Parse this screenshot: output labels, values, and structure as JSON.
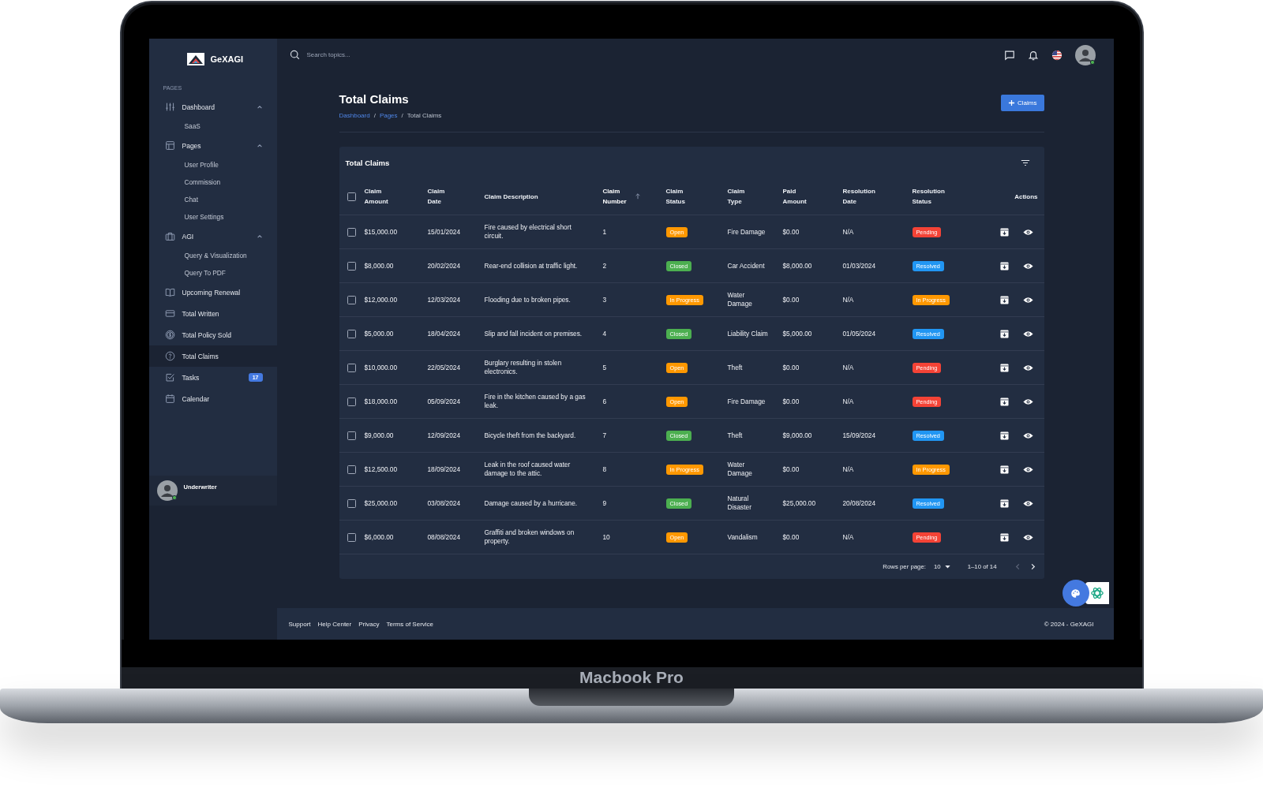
{
  "device": {
    "label": "Macbook Pro"
  },
  "sidebar": {
    "brand": "GeXAGI",
    "section": "PAGES",
    "items": [
      {
        "label": "Dashboard",
        "selected": false,
        "expanded": true,
        "children": [
          {
            "label": "SaaS",
            "selected": false
          }
        ]
      },
      {
        "label": "Pages",
        "selected": false,
        "expanded": true,
        "children": [
          {
            "label": "User Profile",
            "selected": false
          },
          {
            "label": "Commission",
            "selected": false
          },
          {
            "label": "Chat",
            "selected": false
          },
          {
            "label": "User Settings",
            "selected": false
          }
        ]
      },
      {
        "label": "AGI",
        "selected": false,
        "expanded": true,
        "children": [
          {
            "label": "Query & Visualization",
            "selected": false
          },
          {
            "label": "Query To PDF",
            "selected": false
          }
        ]
      },
      {
        "label": "Upcoming Renewal",
        "selected": false
      },
      {
        "label": "Total Written",
        "selected": false
      },
      {
        "label": "Total Policy Sold",
        "selected": false
      },
      {
        "label": "Total Claims",
        "selected": true
      },
      {
        "label": "Tasks",
        "selected": false,
        "badge": "17"
      },
      {
        "label": "Calendar",
        "selected": false
      }
    ],
    "user": {
      "name": "Underwriter",
      "online": true
    }
  },
  "topbar": {
    "search": {
      "placeholder": "Search topics..."
    },
    "avatar_online": true
  },
  "page": {
    "title": "Total Claims",
    "breadcrumb_separator": "/",
    "breadcrumb": [
      {
        "label": "Dashboard",
        "link": true
      },
      {
        "label": "Pages",
        "link": true
      },
      {
        "label": "Total Claims",
        "link": false
      }
    ],
    "add_button": "Claims"
  },
  "table": {
    "title": "Total Claims",
    "all_checked": false,
    "columns": [
      {
        "label": "Claim Amount",
        "sorted": false
      },
      {
        "label": "Claim Date",
        "sorted": false
      },
      {
        "label": "Claim Description",
        "sorted": false
      },
      {
        "label": "Claim Number",
        "sorted": true
      },
      {
        "label": "Claim Status",
        "sorted": false
      },
      {
        "label": "Claim Type",
        "sorted": false
      },
      {
        "label": "Paid Amount",
        "sorted": false
      },
      {
        "label": "Resolution Date",
        "sorted": false
      },
      {
        "label": "Resolution Status",
        "sorted": false
      },
      {
        "label": "Actions",
        "sorted": false
      }
    ],
    "rows": [
      {
        "checked": false,
        "amount": "$15,000.00",
        "date": "15/01/2024",
        "description": "Fire caused by electrical short circuit.",
        "number": "1",
        "status": {
          "label": "Open",
          "color": "#ff9800"
        },
        "type": "Fire Damage",
        "paid": "$0.00",
        "resolution_date": "N/A",
        "resolution_status": {
          "label": "Pending",
          "color": "#f44336"
        }
      },
      {
        "checked": false,
        "amount": "$8,000.00",
        "date": "20/02/2024",
        "description": "Rear-end collision at traffic light.",
        "number": "2",
        "status": {
          "label": "Closed",
          "color": "#4caf50"
        },
        "type": "Car Accident",
        "paid": "$8,000.00",
        "resolution_date": "01/03/2024",
        "resolution_status": {
          "label": "Resolved",
          "color": "#2196f3"
        }
      },
      {
        "checked": false,
        "amount": "$12,000.00",
        "date": "12/03/2024",
        "description": "Flooding due to broken pipes.",
        "number": "3",
        "status": {
          "label": "In Progress",
          "color": "#ff9800"
        },
        "type": "Water Damage",
        "paid": "$0.00",
        "resolution_date": "N/A",
        "resolution_status": {
          "label": "In Progress",
          "color": "#ff9800"
        }
      },
      {
        "checked": false,
        "amount": "$5,000.00",
        "date": "18/04/2024",
        "description": "Slip and fall incident on premises.",
        "number": "4",
        "status": {
          "label": "Closed",
          "color": "#4caf50"
        },
        "type": "Liability Claim",
        "paid": "$5,000.00",
        "resolution_date": "01/05/2024",
        "resolution_status": {
          "label": "Resolved",
          "color": "#2196f3"
        }
      },
      {
        "checked": false,
        "amount": "$10,000.00",
        "date": "22/05/2024",
        "description": "Burglary resulting in stolen electronics.",
        "number": "5",
        "status": {
          "label": "Open",
          "color": "#ff9800"
        },
        "type": "Theft",
        "paid": "$0.00",
        "resolution_date": "N/A",
        "resolution_status": {
          "label": "Pending",
          "color": "#f44336"
        }
      },
      {
        "checked": false,
        "amount": "$18,000.00",
        "date": "05/09/2024",
        "description": "Fire in the kitchen caused by a gas leak.",
        "number": "6",
        "status": {
          "label": "Open",
          "color": "#ff9800"
        },
        "type": "Fire Damage",
        "paid": "$0.00",
        "resolution_date": "N/A",
        "resolution_status": {
          "label": "Pending",
          "color": "#f44336"
        }
      },
      {
        "checked": false,
        "amount": "$9,000.00",
        "date": "12/09/2024",
        "description": "Bicycle theft from the backyard.",
        "number": "7",
        "status": {
          "label": "Closed",
          "color": "#4caf50"
        },
        "type": "Theft",
        "paid": "$9,000.00",
        "resolution_date": "15/09/2024",
        "resolution_status": {
          "label": "Resolved",
          "color": "#2196f3"
        }
      },
      {
        "checked": false,
        "amount": "$12,500.00",
        "date": "18/09/2024",
        "description": "Leak in the roof caused water damage to the attic.",
        "number": "8",
        "status": {
          "label": "In Progress",
          "color": "#ff9800"
        },
        "type": "Water Damage",
        "paid": "$0.00",
        "resolution_date": "N/A",
        "resolution_status": {
          "label": "In Progress",
          "color": "#ff9800"
        }
      },
      {
        "checked": false,
        "amount": "$25,000.00",
        "date": "03/08/2024",
        "description": "Damage caused by a hurricane.",
        "number": "9",
        "status": {
          "label": "Closed",
          "color": "#4caf50"
        },
        "type": "Natural Disaster",
        "paid": "$25,000.00",
        "resolution_date": "20/08/2024",
        "resolution_status": {
          "label": "Resolved",
          "color": "#2196f3"
        }
      },
      {
        "checked": false,
        "amount": "$6,000.00",
        "date": "08/08/2024",
        "description": "Graffiti and broken windows on property.",
        "number": "10",
        "status": {
          "label": "Open",
          "color": "#ff9800"
        },
        "type": "Vandalism",
        "paid": "$0.00",
        "resolution_date": "N/A",
        "resolution_status": {
          "label": "Pending",
          "color": "#f44336"
        }
      }
    ],
    "pagination": {
      "rows_label": "Rows per page:",
      "rows_value": "10",
      "range": "1–10 of 14",
      "prev_disabled": true,
      "next_disabled": false
    }
  },
  "footer": {
    "links": [
      "Support",
      "Help Center",
      "Privacy",
      "Terms of Service"
    ],
    "copyright": "© 2024 - GeXAGI"
  }
}
